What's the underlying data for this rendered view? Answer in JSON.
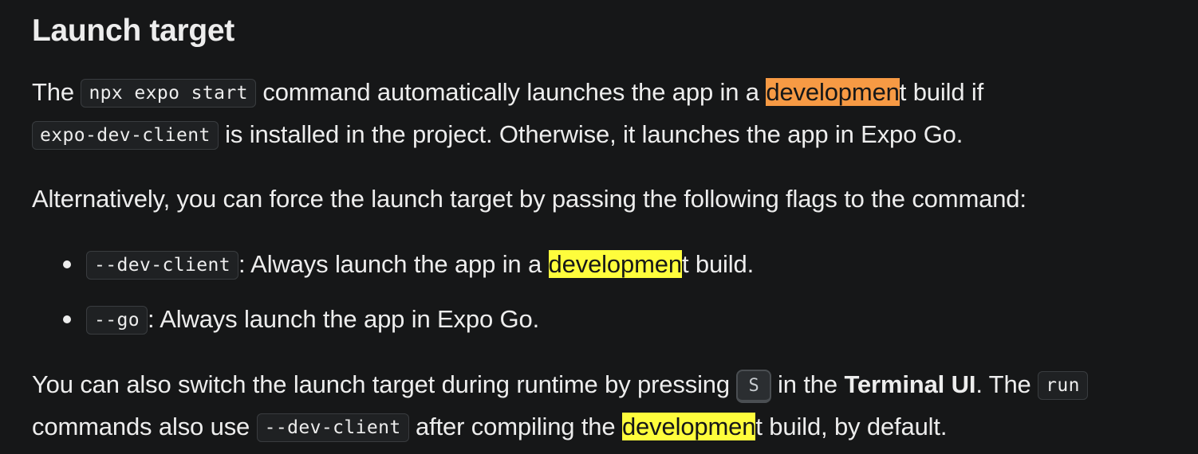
{
  "heading": "Launch target",
  "para1": {
    "t1": "The ",
    "code1": "npx expo start",
    "t2": " command automatically launches the app in a ",
    "hl": "developmen",
    "t3": "t build if",
    "code2": "expo-dev-client",
    "t4": " is installed in the project. Otherwise, it launches the app in Expo Go."
  },
  "para2": {
    "text": "Alternatively, you can force the launch target by passing the following flags to the command:"
  },
  "list": [
    {
      "code": "--dev-client",
      "t1": ": Always launch the app in a ",
      "hl": "developmen",
      "t2": "t build."
    },
    {
      "code": "--go",
      "t1": ": Always launch the app in Expo Go."
    }
  ],
  "para3": {
    "t1": "You can also switch the launch target during runtime by pressing ",
    "key": "S",
    "t2": " in the ",
    "bold": "Terminal UI",
    "t3": ". The ",
    "code1": "run",
    "t4": "commands also use ",
    "code2": "--dev-client",
    "t5": " after compiling the ",
    "hl": "developmen",
    "t6": "t build, by default."
  },
  "colors": {
    "background": "#161718",
    "text": "#ededed",
    "highlight_current": "#f79a44",
    "highlight_match": "#fefd3c"
  }
}
